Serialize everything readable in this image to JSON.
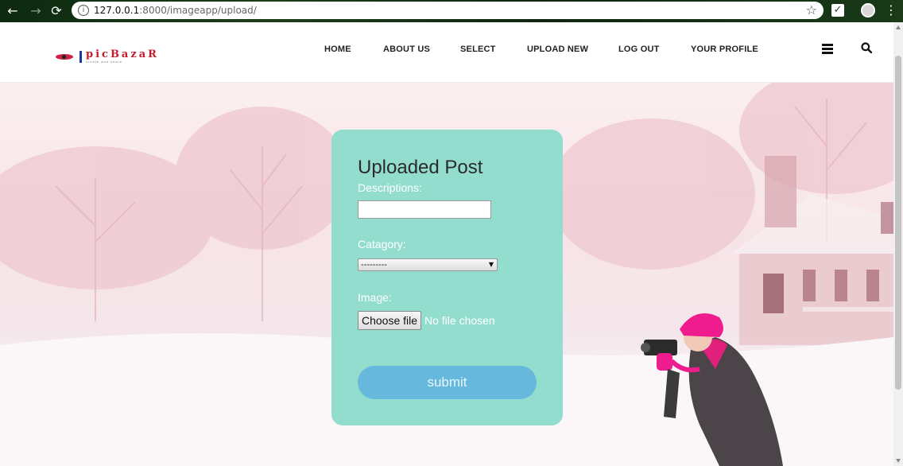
{
  "browser": {
    "url_host": "127.0.0.1",
    "url_rest": ":8000/imageapp/upload/",
    "back_icon": "arrow-left-icon",
    "forward_icon": "arrow-right-icon",
    "reload_icon": "reload-icon",
    "bookmark_icon": "star-icon"
  },
  "header": {
    "logo_text": "picBazaR",
    "logo_tagline": "create and share",
    "nav": [
      "HOME",
      "ABOUT US",
      "SELECT",
      "UPLOAD NEW",
      "LOG OUT",
      "YOUR PROFILE"
    ]
  },
  "form": {
    "title": "Uploaded Post",
    "description_label": "Descriptions:",
    "description_value": "",
    "category_label": "Catagory:",
    "category_selected": "---------",
    "image_label": "Image:",
    "choose_file_label": "Choose file",
    "file_status": "No file chosen",
    "submit_label": "submit"
  },
  "colors": {
    "card": "#93ddcf",
    "submit": "#67b8dd",
    "logo": "#c41a2a"
  }
}
